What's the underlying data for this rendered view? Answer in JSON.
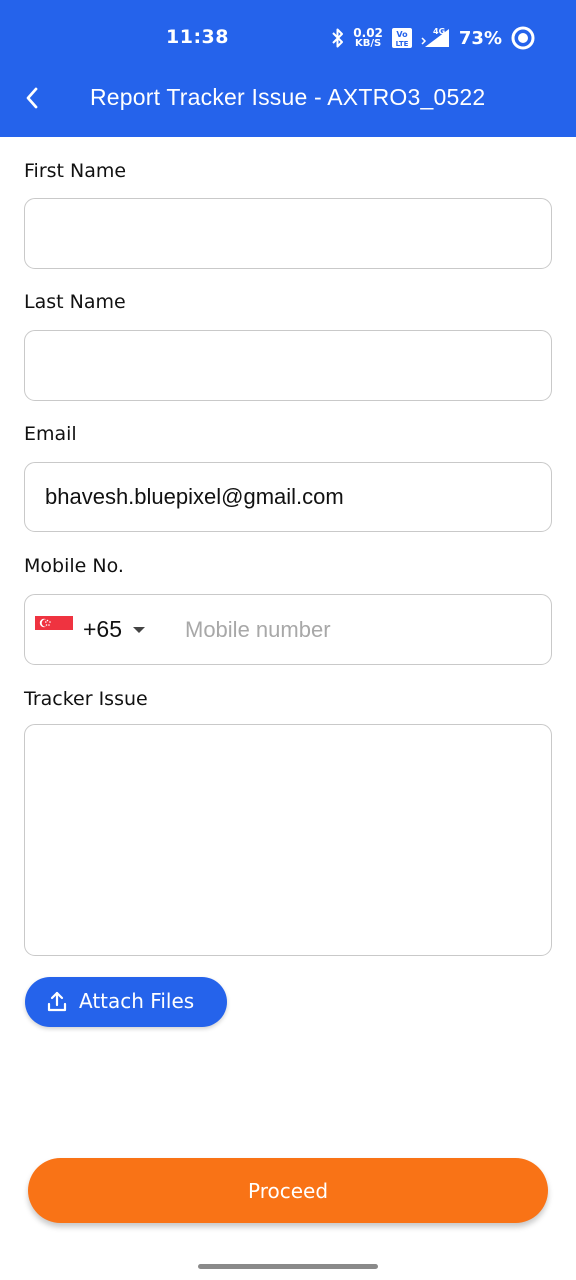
{
  "status_bar": {
    "time": "11:38",
    "net_speed_value": "0.02",
    "net_speed_unit": "KB/S",
    "volte_label": "Vo LTE",
    "network_label": "4G",
    "battery_percent": "73%"
  },
  "toolbar": {
    "title": "Report Tracker Issue - AXTRO3_0522"
  },
  "form": {
    "first_name": {
      "label": "First Name",
      "value": "",
      "placeholder": ""
    },
    "last_name": {
      "label": "Last Name",
      "value": "",
      "placeholder": ""
    },
    "email": {
      "label": "Email",
      "value": "bhavesh.bluepixel@gmail.com",
      "placeholder": ""
    },
    "mobile": {
      "label": "Mobile No.",
      "dial_code": "+65",
      "value": "",
      "placeholder": "Mobile number"
    },
    "tracker_issue": {
      "label": "Tracker Issue",
      "value": "",
      "placeholder": ""
    }
  },
  "actions": {
    "attach_label": "Attach Files",
    "proceed_label": "Proceed"
  },
  "colors": {
    "primary_blue": "#2563eb",
    "accent_orange": "#f97316",
    "border_gray": "#c9c9c9",
    "flag_red": "#ef3340"
  },
  "icons": {
    "back": "chevron-left-icon",
    "attach": "upload-icon",
    "country_dropdown": "caret-down-icon",
    "flag": "singapore-flag-icon"
  }
}
